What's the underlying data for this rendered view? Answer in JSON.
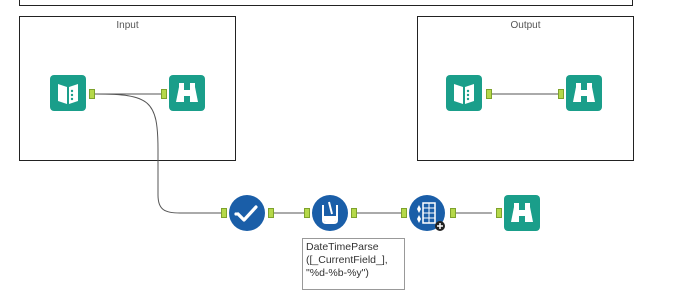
{
  "canvas": {
    "containers": [
      {
        "title": "Input"
      },
      {
        "title": "Output"
      }
    ],
    "tools": [
      {
        "name": "input-data-tool",
        "icon": "book-icon"
      },
      {
        "name": "browse-tool-input",
        "icon": "binoculars-icon"
      },
      {
        "name": "select-tool",
        "icon": "checkmark-icon"
      },
      {
        "name": "formula-tool",
        "icon": "beaker-icon"
      },
      {
        "name": "multi-field-formula-tool",
        "icon": "multi-formula-icon"
      },
      {
        "name": "browse-tool-final",
        "icon": "binoculars-icon"
      },
      {
        "name": "output-data-tool",
        "icon": "book-icon"
      },
      {
        "name": "browse-tool-output",
        "icon": "binoculars-icon"
      }
    ],
    "annotation": {
      "line1": "DateTimeParse",
      "line2": "([_CurrentField_],",
      "line3": "\"%d-%b-%y\")"
    }
  },
  "colors": {
    "teal": "#1a9e8a",
    "blue": "#1a5ea8",
    "anchor": "#b5d84a",
    "wire": "#555555"
  }
}
